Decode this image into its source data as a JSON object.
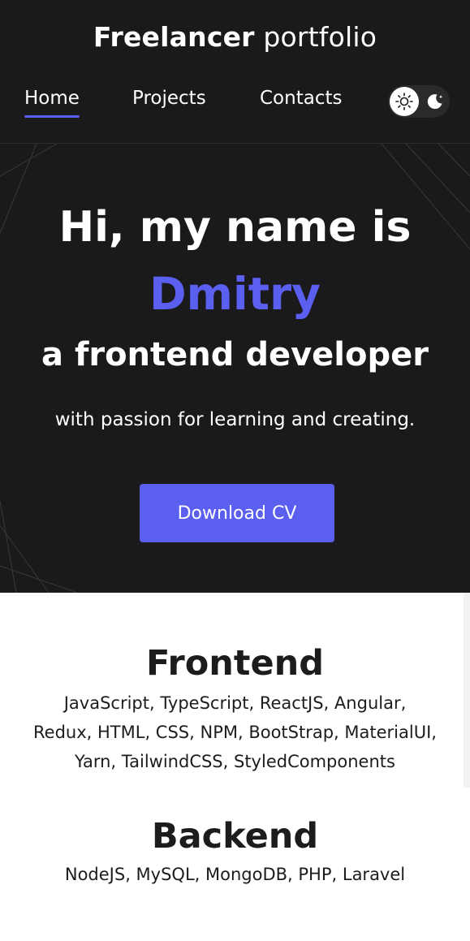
{
  "header": {
    "brand_bold": "Freelancer",
    "brand_light": "portfolio",
    "nav": [
      {
        "label": "Home",
        "active": true
      },
      {
        "label": "Projects",
        "active": false
      },
      {
        "label": "Contacts",
        "active": false
      }
    ],
    "theme_toggle": {
      "state": "light",
      "icons": [
        "sun-icon",
        "moon-icon"
      ]
    }
  },
  "hero": {
    "line1": "Hi, my name is",
    "name": "Dmitry",
    "line3": "a frontend developer",
    "tagline": "with passion for learning and creating.",
    "cta_label": "Download CV"
  },
  "skills": [
    {
      "title": "Frontend",
      "text": "JavaScript, TypeScript, ReactJS, Angular, Redux, HTML, CSS, NPM, BootStrap, MaterialUI, Yarn, TailwindCSS, StyledComponents"
    },
    {
      "title": "Backend",
      "text": "NodeJS, MySQL, MongoDB, PHP, Laravel"
    }
  ],
  "colors": {
    "accent": "#5b5ff0",
    "dark_bg": "#1a191b",
    "text_dark": "#1c1c1c",
    "text_light": "#ffffff"
  }
}
